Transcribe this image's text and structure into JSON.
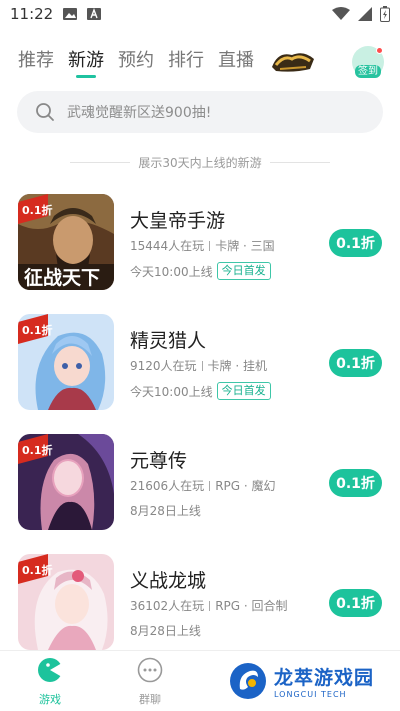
{
  "status": {
    "time": "11:22"
  },
  "tabs": [
    {
      "label": "推荐"
    },
    {
      "label": "新游"
    },
    {
      "label": "预约"
    },
    {
      "label": "排行"
    },
    {
      "label": "直播"
    }
  ],
  "signin_label": "签到",
  "search": {
    "placeholder": "武魂觉醒新区送900抽!"
  },
  "caption": "展示30天内上线的新游",
  "games": [
    {
      "name": "大皇帝手游",
      "players": "15444人在玩",
      "tags": "卡牌 · 三国",
      "date": "今天10:00上线",
      "badge": "今日首发",
      "discount": "0.1折",
      "cover_text": "0.1折",
      "cover_title": "征战天下"
    },
    {
      "name": "精灵猎人",
      "players": "9120人在玩",
      "tags": "卡牌 · 挂机",
      "date": "今天10:00上线",
      "badge": "今日首发",
      "discount": "0.1折",
      "cover_text": "0.1折"
    },
    {
      "name": "元尊传",
      "players": "21606人在玩",
      "tags": "RPG · 魔幻",
      "date": "8月28日上线",
      "discount": "0.1折",
      "cover_text": "0.1折"
    },
    {
      "name": "义战龙城",
      "players": "36102人在玩",
      "tags": "RPG · 回合制",
      "date": "8月28日上线",
      "discount": "0.1折",
      "cover_text": "0.1折"
    }
  ],
  "bottom_nav": [
    {
      "label": "游戏"
    },
    {
      "label": "群聊"
    }
  ],
  "watermark": {
    "title": "龙萃游戏园",
    "subtitle": "LONGCUI TECH"
  },
  "colors": {
    "accent": "#1dc39c",
    "brand_blue": "#1b63c6"
  }
}
